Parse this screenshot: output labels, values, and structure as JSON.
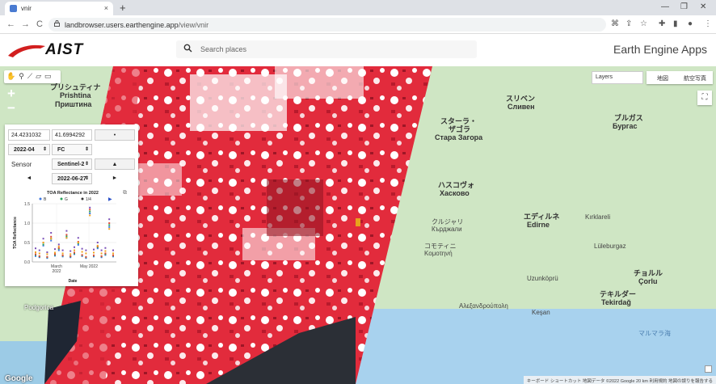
{
  "browser": {
    "tab_title": "vnir",
    "tab_close": "×",
    "new_tab": "+",
    "minimize": "—",
    "maximize": "❐",
    "close": "✕",
    "back": "←",
    "forward": "→",
    "reload": "C",
    "url_domain": "landbrowser.users.earthengine.app",
    "url_path": "/view/vnir"
  },
  "header": {
    "logo_text": "AIST",
    "search_placeholder": "Search places",
    "app_title": "Earth Engine Apps"
  },
  "map": {
    "zoom_in": "+",
    "zoom_out": "−",
    "layers_label": "Layers",
    "map_type_map": "地図",
    "map_type_satellite": "航空写真",
    "fullscreen": "⛶",
    "attribution": "キーボード ショートカット  地図データ ©2022 Google  20 km  利用規約  地図の誤りを報告する",
    "google": "Google",
    "labels": {
      "pristina_jp": "プリシュティナ",
      "pristina": "Prishtina",
      "pristina_cy": "Приштина",
      "sliven_jp": "スリベン",
      "sliven": "Сливен",
      "stara_zagora_jp1": "スターラ・",
      "stara_zagora_jp2": "ザゴラ",
      "stara_zagora": "Стара Загора",
      "burgas_jp": "ブルガス",
      "burgas": "Бургас",
      "haskovo_jp": "ハスコヴォ",
      "haskovo": "Хасково",
      "edirne_jp": "エディルネ",
      "edirne": "Edirne",
      "kirklareli": "Kırklareli",
      "corlu_jp": "チョルル",
      "corlu": "Çorlu",
      "tekirdag_jp": "テキルダー",
      "tekirdag": "Tekirdağ",
      "komotini_jp": "コモティニ",
      "komotini": "Κομοτηνή",
      "kardzhali_jp": "クルジャリ",
      "kardzhali": "Кърджали",
      "alexandroupoli": "Αλεξανδρούπολη",
      "lulebergaz": "Lüleburgaz",
      "podgorica": "Podgorica",
      "marmara": "マルマラ海",
      "kesan": "Keşan",
      "uzunkopru": "Uzunköprü"
    }
  },
  "panel": {
    "lon": "24.4231032",
    "lat": "41.6994292",
    "dot_button": "•",
    "month": "2022-04",
    "composite": "FC",
    "sensor_label": "Sensor",
    "sensor": "Sentinel-2",
    "up_button": "▲",
    "prev_button": "◄",
    "next_button": "►",
    "date": "2022-06-27"
  },
  "chart_data": {
    "type": "scatter",
    "title": "TOA Reflectance in 2022",
    "legend": [
      "B",
      "G",
      "1/4"
    ],
    "xlabel": "Date",
    "ylabel": "TOA Reflectance",
    "xticks": [
      "March\n2022",
      "May 2022"
    ],
    "yticks": [
      "0.0",
      "0.5",
      "1.0",
      "1.5"
    ],
    "ylim": [
      0,
      1.5
    ],
    "colors": {
      "B": "#3d75e0",
      "G": "#29a35a",
      "R": "#e04a3a",
      "NIR": "#7a4fb8",
      "SWIR": "#f0a21e"
    },
    "series": [
      {
        "name": "B",
        "values": [
          0.15,
          0.12,
          0.42,
          0.1,
          0.55,
          0.16,
          0.3,
          0.14,
          0.62,
          0.12,
          0.2,
          0.44,
          0.15,
          0.1,
          1.25,
          0.14,
          0.35,
          0.12,
          0.18,
          0.9,
          0.14
        ]
      },
      {
        "name": "G",
        "values": [
          0.18,
          0.14,
          0.45,
          0.12,
          0.6,
          0.18,
          0.34,
          0.16,
          0.66,
          0.14,
          0.22,
          0.48,
          0.17,
          0.12,
          1.3,
          0.16,
          0.38,
          0.14,
          0.2,
          0.95,
          0.16
        ]
      },
      {
        "name": "",
        "values": [
          0.2,
          0.15,
          0.5,
          0.13,
          0.65,
          0.2,
          0.36,
          0.17,
          0.7,
          0.15,
          0.24,
          0.52,
          0.18,
          0.13,
          1.35,
          0.17,
          0.4,
          0.15,
          0.22,
          1.0,
          0.17
        ]
      },
      {
        "name": "",
        "values": [
          0.35,
          0.3,
          0.6,
          0.25,
          0.75,
          0.33,
          0.45,
          0.3,
          0.8,
          0.28,
          0.38,
          0.62,
          0.34,
          0.3,
          1.4,
          0.32,
          0.5,
          0.3,
          0.36,
          1.1,
          0.3
        ]
      },
      {
        "name": "",
        "values": [
          0.25,
          0.22,
          0.5,
          0.2,
          0.6,
          0.24,
          0.4,
          0.22,
          0.62,
          0.2,
          0.3,
          0.5,
          0.26,
          0.22,
          1.2,
          0.24,
          0.42,
          0.22,
          0.28,
          0.85,
          0.22
        ]
      }
    ]
  }
}
